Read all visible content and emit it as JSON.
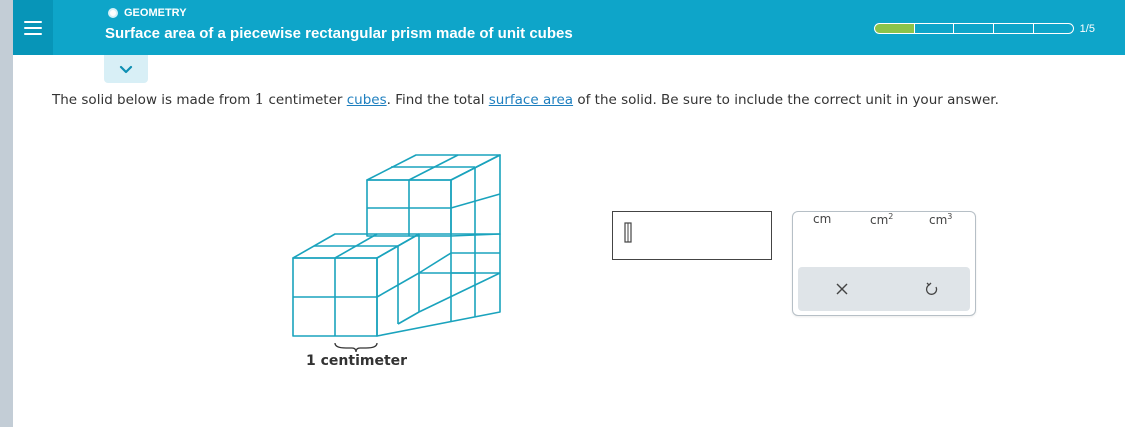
{
  "header": {
    "subject": "GEOMETRY",
    "topic": "Surface area of a piecewise rectangular prism made of unit cubes",
    "progress": {
      "current": 1,
      "total": 5,
      "label": "1/5",
      "filled_segments": 1,
      "segments": 5
    },
    "accent_color": "#0ea5c9",
    "progress_color": "#8bc34a"
  },
  "question": {
    "part1": "The solid below is made from ",
    "number": "1",
    "part2": " centimeter ",
    "link1": "cubes",
    "part3": ". Find the total ",
    "link2": "surface area",
    "part4": " of the solid. Be sure to include the correct unit in your answer."
  },
  "figure": {
    "scale_label": "1 centimeter",
    "stroke_color": "#1aa3bd"
  },
  "answer": {
    "value": ""
  },
  "keypad": {
    "units": [
      {
        "base": "cm",
        "exp": ""
      },
      {
        "base": "cm",
        "exp": "2"
      },
      {
        "base": "cm",
        "exp": "3"
      }
    ],
    "clear_icon": "x-icon",
    "undo_icon": "undo-icon"
  }
}
